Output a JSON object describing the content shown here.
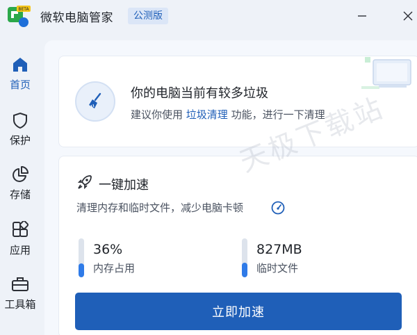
{
  "titlebar": {
    "app_title": "微软电脑管家",
    "edition_badge": "公测版",
    "logo_badge": "BETA"
  },
  "sidebar": {
    "items": [
      {
        "label": "首页",
        "icon": "home-icon",
        "active": true
      },
      {
        "label": "保护",
        "icon": "shield-icon",
        "active": false
      },
      {
        "label": "存储",
        "icon": "pie-chart-icon",
        "active": false
      },
      {
        "label": "应用",
        "icon": "apps-grid-icon",
        "active": false
      },
      {
        "label": "工具箱",
        "icon": "toolbox-icon",
        "active": false
      }
    ]
  },
  "status_card": {
    "title": "你的电脑当前有较多垃圾",
    "sub_prefix": "建议你使用 ",
    "sub_link": "垃圾清理",
    "sub_suffix": " 功能，进行一下清理",
    "icon": "broom-icon"
  },
  "speed_card": {
    "title": "一键加速",
    "subtitle": "清理内存和临时文件，减少电脑卡顿",
    "header_icon": "rocket-icon",
    "memory": {
      "value": "36%",
      "label": "内存占用",
      "fill_fraction": 0.36
    },
    "temp_files": {
      "value": "827MB",
      "label": "临时文件",
      "fill_fraction": 0.38
    },
    "button_label": "立即加速"
  },
  "watermark": "天极下载站",
  "colors": {
    "accent": "#1f5fb8",
    "meter_fill": "#2f7be8",
    "background": "#eef2f8"
  }
}
